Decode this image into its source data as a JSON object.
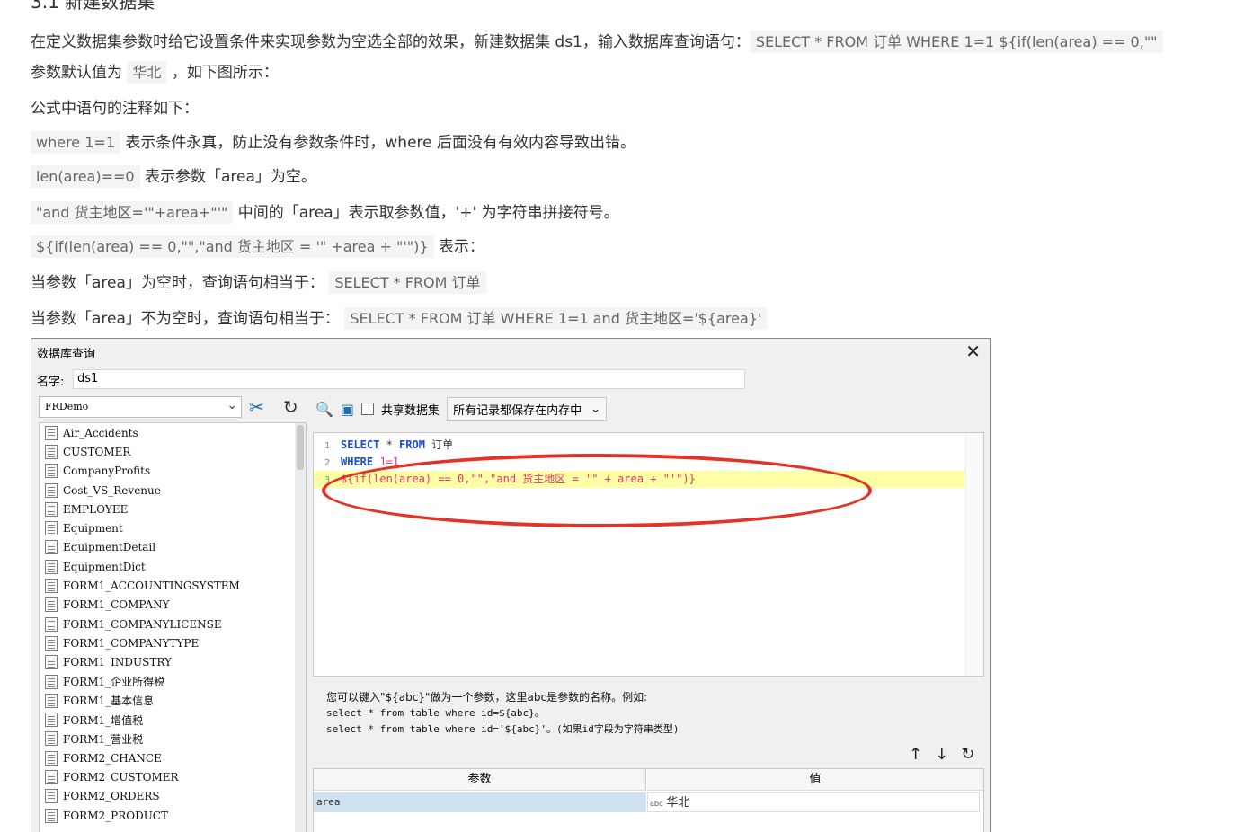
{
  "article": {
    "heading": "3.1 新建数据集",
    "p1_text": "在定义数据集参数时给它设置条件来实现参数为空选全部的效果，新建数据集 ds1，输入数据库查询语句：",
    "p1_code": "SELECT * FROM 订单  WHERE 1=1  ${if(len(area) == 0,\"\"",
    "p2_text_a": "参数默认值为",
    "p2_code": "华北",
    "p2_text_b": "，如下图所示：",
    "p3": "公式中语句的注释如下：",
    "n1_code": "where 1=1",
    "n1_text": "表示条件永真，防止没有参数条件时，where 后面没有有效内容导致出错。",
    "n2_code": "len(area)==0",
    "n2_text": "表示参数「area」为空。",
    "n3_code": "\"and 货主地区='\"+area+\"'\"",
    "n3_text": "中间的「area」表示取参数值，'+' 为字符串拼接符号。",
    "n4_code": "${if(len(area) == 0,\"\",\"and 货主地区 = '\" +area + \"'\")}",
    "n4_text": "表示：",
    "n5_text": "当参数「area」为空时，查询语句相当于：",
    "n5_code": "SELECT * FROM 订单",
    "n6_text": "当参数「area」不为空时，查询语句相当于：",
    "n6_code": "SELECT * FROM 订单 WHERE 1=1 and 货主地区='${area}'"
  },
  "dialog": {
    "title": "数据库查询",
    "close": "✕",
    "name_label": "名字:",
    "name_value": "ds1",
    "db_select": "FRDemo",
    "share_label": "共享数据集",
    "cache_option": "所有记录都保存在内存中",
    "tables": [
      "Air_Accidents",
      "CUSTOMER",
      "CompanyProfits",
      "Cost_VS_Revenue",
      "EMPLOYEE",
      "Equipment",
      "EquipmentDetail",
      "EquipmentDict",
      "FORM1_ACCOUNTINGSYSTEM",
      "FORM1_COMPANY",
      "FORM1_COMPANYLICENSE",
      "FORM1_COMPANYTYPE",
      "FORM1_INDUSTRY",
      "FORM1_企业所得税",
      "FORM1_基本信息",
      "FORM1_增值税",
      "FORM1_营业税",
      "FORM2_CHANCE",
      "FORM2_CUSTOMER",
      "FORM2_ORDERS",
      "FORM2_PRODUCT"
    ],
    "sql_lines": [
      {
        "n": "1",
        "kw": "SELECT",
        "rest": " * ",
        "kw2": "FROM",
        "tail": " 订单"
      },
      {
        "n": "2",
        "kw": "WHERE",
        "rest": " ",
        "num": "1=1"
      },
      {
        "n": "3",
        "code": "${if(len(area) == 0,\"\",\"and 货主地区 = '\" + area + \"'\")}"
      }
    ],
    "hint_line1": "您可以键入\"${abc}\"做为一个参数，这里abc是参数的名称。例如:",
    "hint_line2": "select * from table where id=${abc}。",
    "hint_line3": "select * from table where id='${abc}'。(如果id字段为字符串类型)",
    "param_col": "参数",
    "value_col": "值",
    "param_name": "area",
    "param_value": "华北",
    "accent_color": "#e53226"
  }
}
